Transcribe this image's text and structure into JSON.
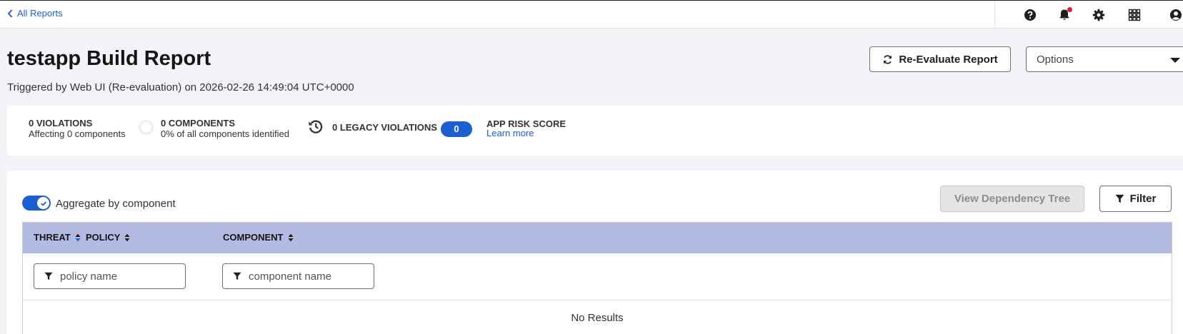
{
  "nav": {
    "back_label": "All Reports"
  },
  "header_icons": [
    "help-icon",
    "bell-icon",
    "gear-icon",
    "apps-grid-icon",
    "user-icon"
  ],
  "page": {
    "title": "testapp Build Report",
    "subtitle": "Triggered by Web UI (Re-evaluation) on 2026-02-26 14:49:04 UTC+0000"
  },
  "actions": {
    "reevaluate_label": "Re-Evaluate Report",
    "options_label": "Options"
  },
  "summary": {
    "violations_label": "0 VIOLATIONS",
    "violations_sub": "Affecting 0 components",
    "components_label": "0 COMPONENTS",
    "components_sub": "0% of all components identified",
    "legacy_label": "0 LEGACY VIOLATIONS",
    "risk_score_value": "0",
    "risk_score_label": "APP RISK SCORE",
    "learn_more": "Learn more"
  },
  "controls": {
    "aggregate_label": "Aggregate by component",
    "aggregate_on": true,
    "view_tree_label": "View Dependency Tree",
    "filter_label": "Filter"
  },
  "table": {
    "columns": [
      "THREAT",
      "POLICY",
      "COMPONENT"
    ],
    "policy_placeholder": "policy name",
    "component_placeholder": "component name",
    "empty_text": "No Results"
  },
  "colors": {
    "accent": "#1b5fd0",
    "header_bg": "#b4bbe2",
    "page_bg": "#f3f4f8",
    "notification_dot": "#d41f3a"
  }
}
